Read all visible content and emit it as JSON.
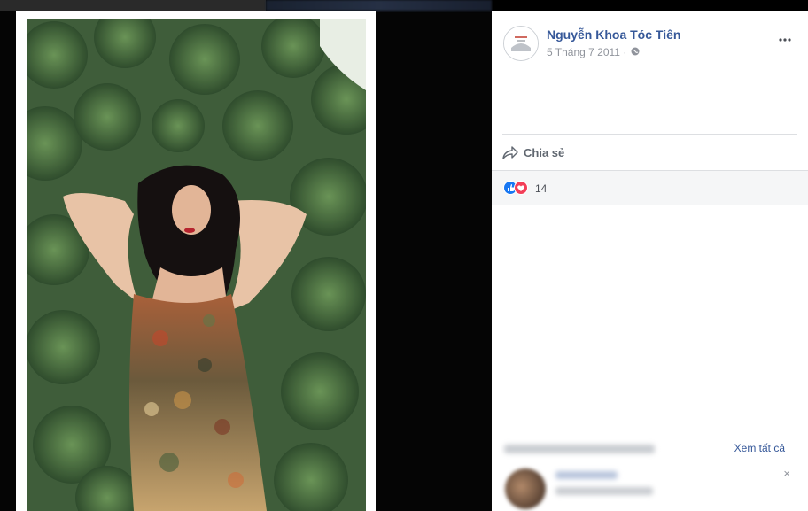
{
  "post": {
    "author": "Nguyễn Khoa Tóc Tiên",
    "date": "5 Tháng 7 2011",
    "date_separator": "·"
  },
  "actions": {
    "share_label": "Chia sẻ"
  },
  "reactions": {
    "count": "14",
    "types": [
      "like-icon",
      "love-icon"
    ]
  },
  "comments": {
    "see_all_label": "Xem tất cả",
    "close_label": "×"
  },
  "colors": {
    "link": "#365899",
    "muted": "#90949c",
    "like": "#1877f2",
    "love": "#f33e58"
  }
}
